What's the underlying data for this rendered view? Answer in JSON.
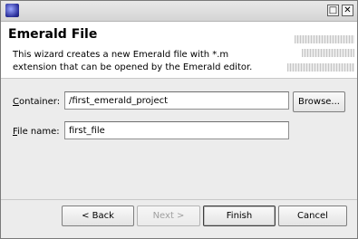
{
  "window": {
    "title": ""
  },
  "banner": {
    "title": "Emerald File",
    "description": "This wizard creates a new Emerald file with *.m extension that can be opened by the Emerald editor."
  },
  "form": {
    "container": {
      "label_mnemonic": "C",
      "label_rest": "ontainer:",
      "value": "/first_emerald_project",
      "browse_label": "Browse..."
    },
    "file_name": {
      "label_mnemonic": "F",
      "label_rest": "ile name:",
      "value": "first_file"
    }
  },
  "buttons": {
    "back": "< Back",
    "next": "Next >",
    "finish": "Finish",
    "cancel": "Cancel"
  },
  "icons": {
    "app": "eclipse-icon",
    "maximize": "maximize-icon",
    "close": "close-icon"
  }
}
